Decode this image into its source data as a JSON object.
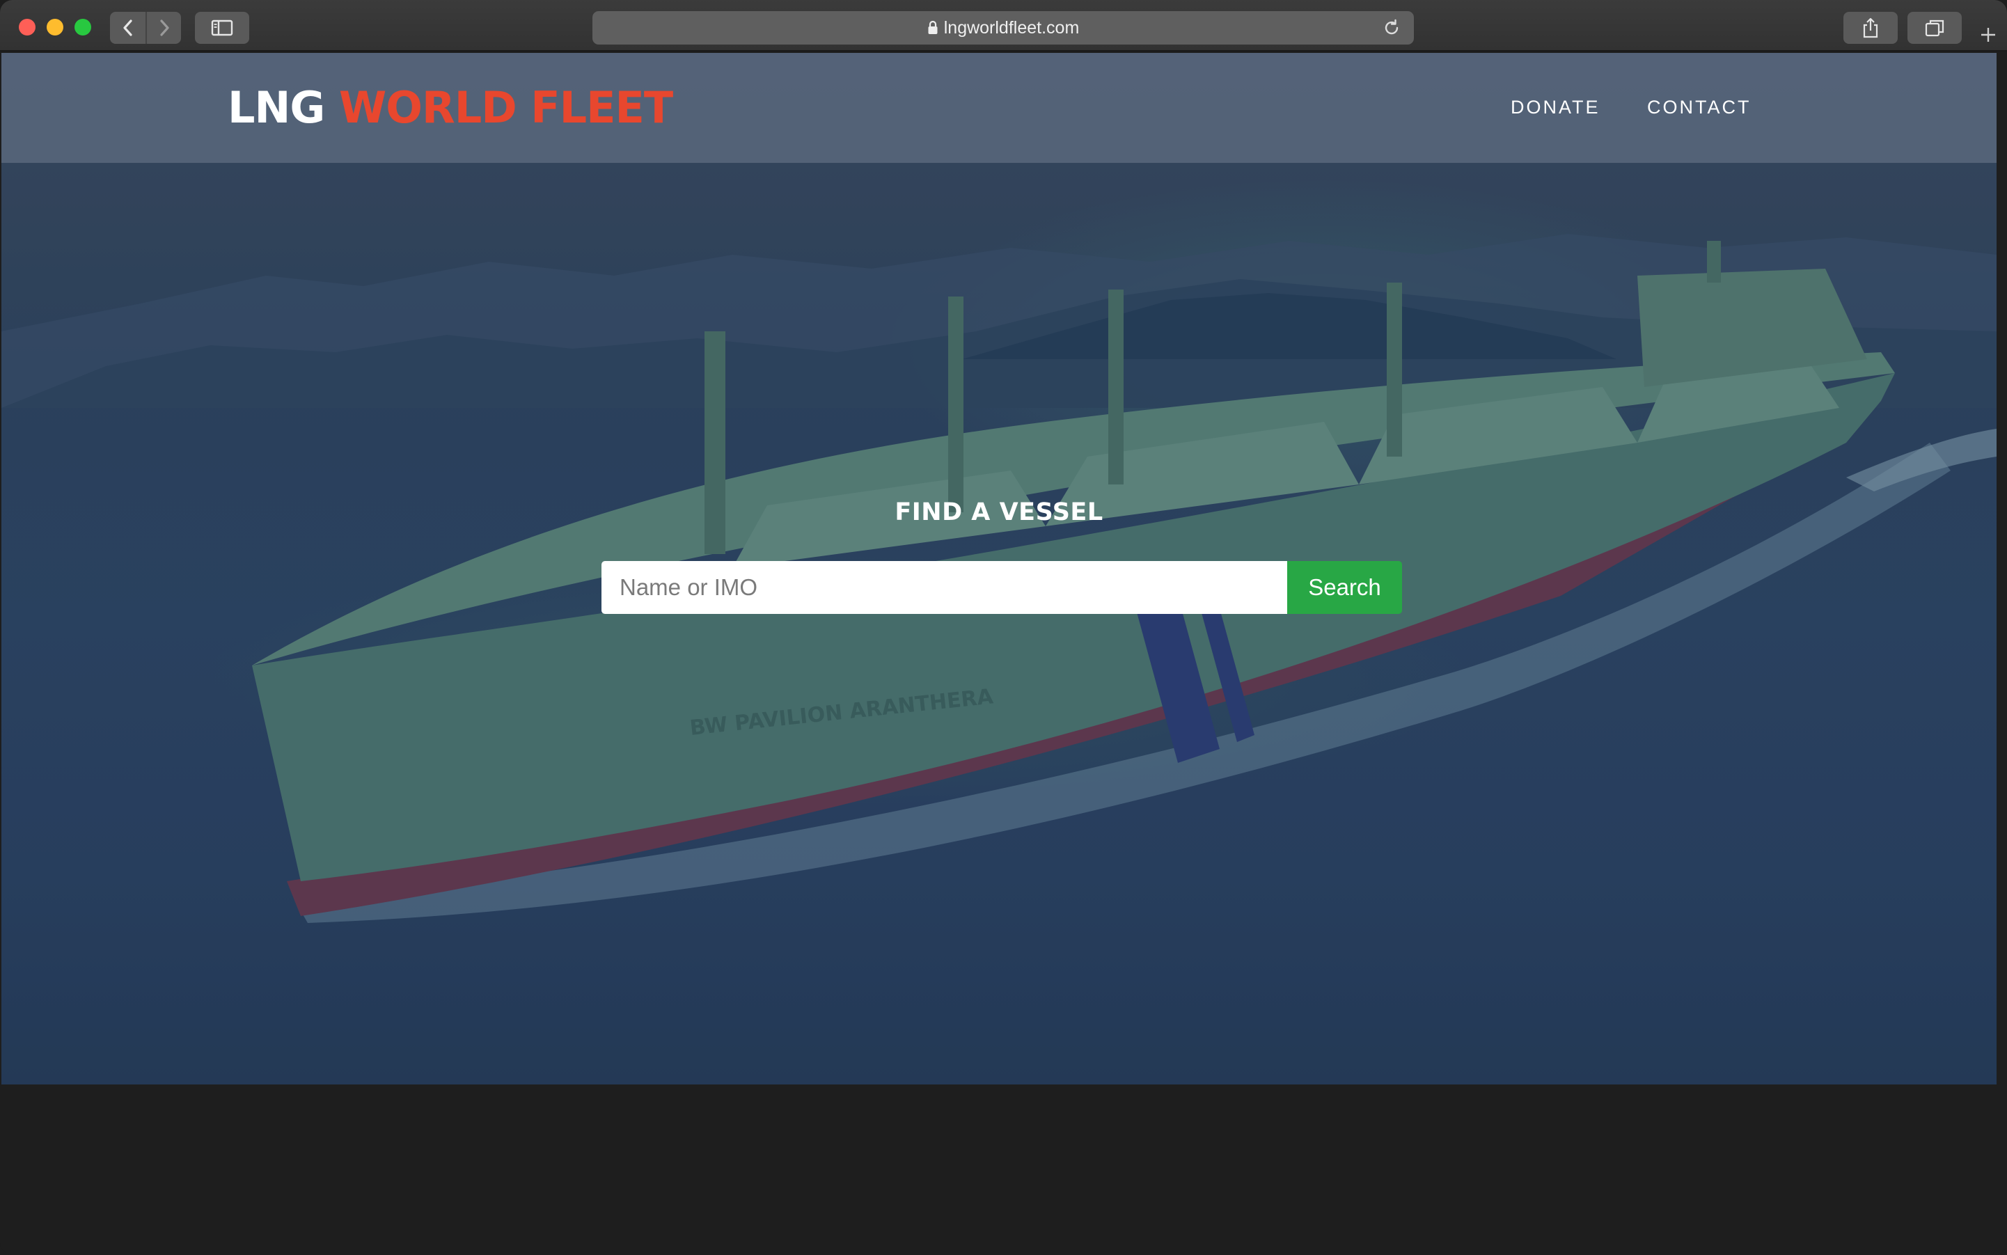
{
  "browser": {
    "address": "lngworldfleet.com",
    "icons": {
      "back": "chevron-left-icon",
      "forward": "chevron-right-icon",
      "sidebar": "sidebar-icon",
      "lock": "lock-icon",
      "reload": "reload-icon",
      "share": "share-icon",
      "tabs": "tabs-overview-icon",
      "new_tab": "plus-icon"
    }
  },
  "header": {
    "logo_part1": "LNG",
    "logo_part2": "WORLD FLEET",
    "nav": [
      {
        "label": "DONATE"
      },
      {
        "label": "CONTACT"
      }
    ]
  },
  "hero": {
    "title": "FIND A VESSEL",
    "search": {
      "placeholder": "Name or IMO",
      "value": "",
      "button_label": "Search"
    },
    "ship_hull_text": "BW PAVILION ARANTHERA"
  },
  "colors": {
    "logo_accent": "#e8472e",
    "search_button": "#28a745",
    "header_bg": "#5f6e82"
  }
}
